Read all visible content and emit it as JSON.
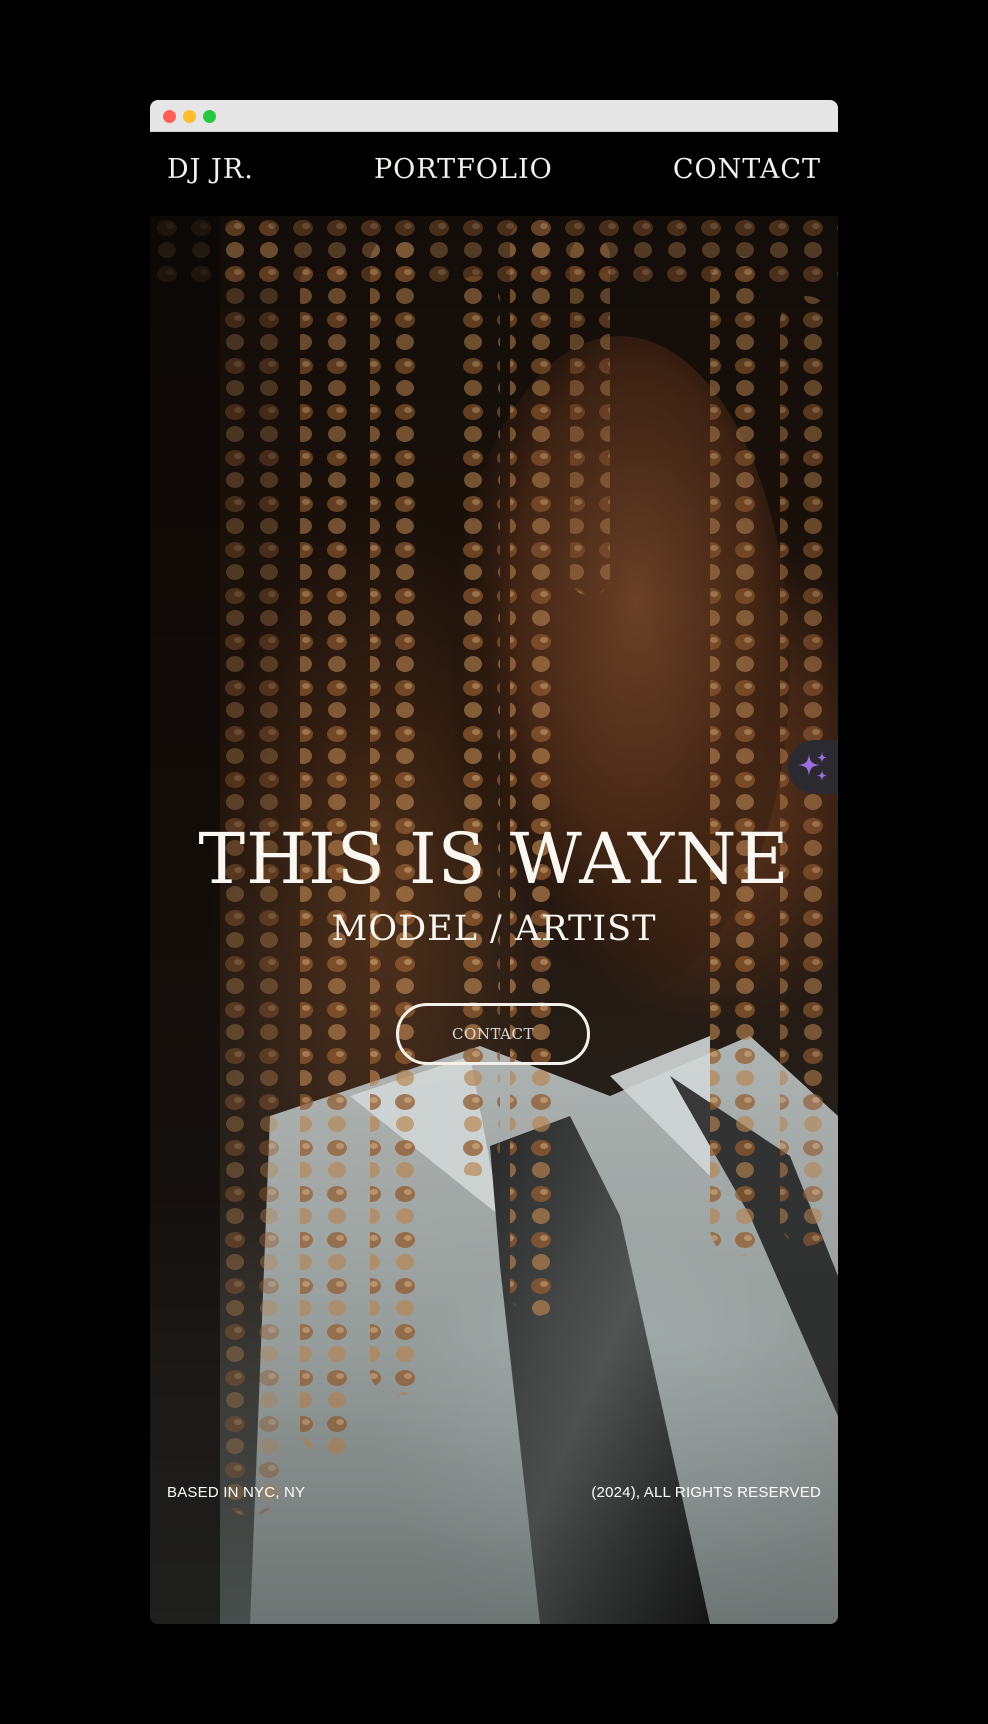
{
  "nav": {
    "brand": "DJ JR.",
    "portfolio": "PORTFOLIO",
    "contact": "CONTACT"
  },
  "hero": {
    "title": "THIS IS WAYNE",
    "subtitle": "MODEL / ARTIST",
    "button_label": "CONTACT"
  },
  "footer": {
    "location": "BASED IN NYC, NY",
    "rights": "(2024), ALL RIGHTS RESERVED"
  },
  "icons": {
    "assistant": "sparkles-icon"
  },
  "colors": {
    "background": "#000000",
    "text": "#f4f1ea",
    "sparkle": "#9b6fe0",
    "titlebar": "#e6e6e6"
  }
}
